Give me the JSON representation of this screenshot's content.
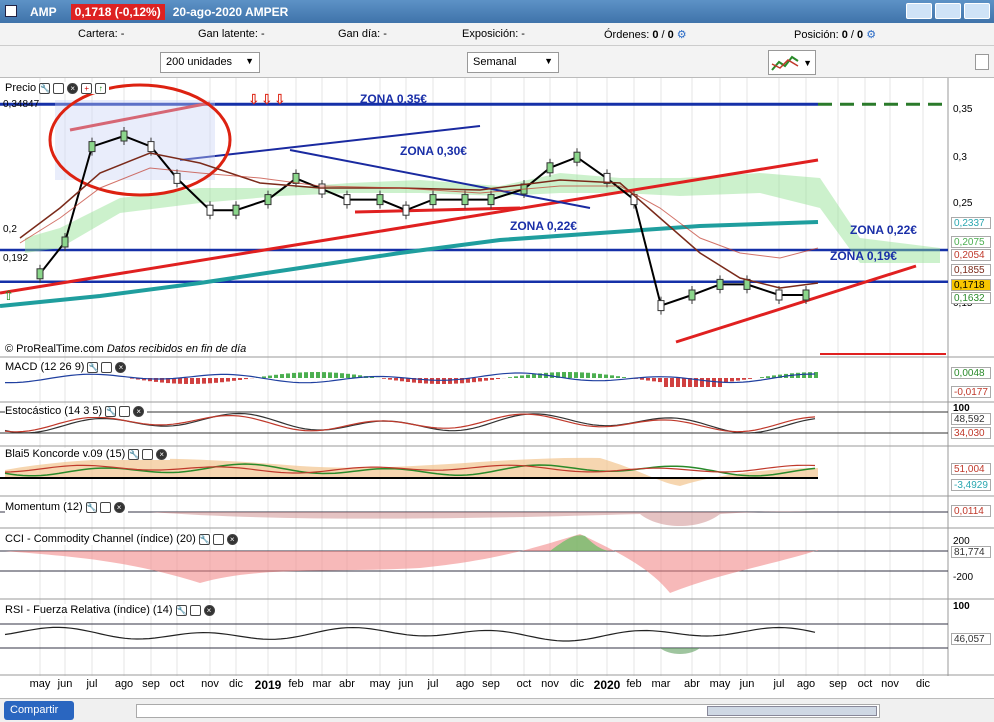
{
  "window": {
    "symbol": "AMP",
    "price_badge": "0,1718 (-0,12%)",
    "date_label": "20-ago-2020 AMPER"
  },
  "info": {
    "cartera": "Cartera: -",
    "gan_latente": "Gan latente: -",
    "gan_dia": "Gan día: -",
    "exposicion": "Exposición: -",
    "ordenes_label": "Órdenes: ",
    "ordenes_a": "0",
    "ordenes_b": "0",
    "posicion_label": "Posición: ",
    "posicion_a": "0",
    "posicion_b": "0"
  },
  "toolbar": {
    "units_select": "200 unidades",
    "period_select": "Semanal"
  },
  "panels": {
    "price": {
      "label": "Precio",
      "last_value": "0,34847",
      "left_value_1": "0,2",
      "left_value_2": "0,192",
      "copyright": "© ProRealTime.com",
      "copyright_note": "Datos recibidos en fin de día"
    },
    "macd": {
      "label": "MACD (12 26 9)"
    },
    "stoch": {
      "label": "Estocástico (14 3 5)"
    },
    "koncorde": {
      "label": "Blai5 Koncorde v.09 (15)"
    },
    "momentum": {
      "label": "Momentum (12)"
    },
    "cci": {
      "label": "CCI - Commodity Channel (índice) (20)"
    },
    "rsi": {
      "label": "RSI - Fuerza Relativa (índice) (14)"
    }
  },
  "zones": {
    "z035": "ZONA 0,35€",
    "z030": "ZONA 0,30€",
    "z022_mid": "ZONA 0,22€",
    "z022_right": "ZONA 0,22€",
    "z019": "ZONA 0,19€"
  },
  "price_axis": {
    "ticks": [
      "0,35",
      "0,3",
      "0,25",
      "0,2",
      "0,15"
    ],
    "tags": [
      {
        "text": "0,2337",
        "color": "#2aa7b0"
      },
      {
        "text": "0,2075",
        "color": "#4caf50"
      },
      {
        "text": "0,2054",
        "color": "#c0392b"
      },
      {
        "text": "0,1855",
        "color": "#7a2a1a"
      },
      {
        "text": "0,1718",
        "color": "#000000",
        "bg": "#f7c600"
      },
      {
        "text": "0,1632",
        "color": "#2a8a2a"
      }
    ]
  },
  "indicator_tags": {
    "macd": [
      {
        "text": "0,0048",
        "color": "#2a8a2a"
      },
      {
        "text": "-0,0177",
        "color": "#c0392b"
      }
    ],
    "stoch": [
      {
        "text": "100",
        "color": "#000"
      },
      {
        "text": "48,592",
        "color": "#333"
      },
      {
        "text": "34,030",
        "color": "#c0392b"
      }
    ],
    "koncorde": [
      {
        "text": "51,004",
        "color": "#c0392b"
      },
      {
        "text": "-3,4929",
        "color": "#2aa7b0"
      }
    ],
    "momentum": [
      {
        "text": "0,0114",
        "color": "#c0392b"
      }
    ],
    "cci": [
      {
        "text": "200",
        "color": "#000"
      },
      {
        "text": "81,774",
        "color": "#333"
      },
      {
        "text": "-200",
        "color": "#000"
      }
    ],
    "rsi": [
      {
        "text": "100",
        "color": "#000"
      },
      {
        "text": "46,057",
        "color": "#333"
      }
    ]
  },
  "time_axis": [
    {
      "label": "may",
      "bold": false
    },
    {
      "label": "jun",
      "bold": false
    },
    {
      "label": "jul",
      "bold": false
    },
    {
      "label": "ago",
      "bold": false
    },
    {
      "label": "sep",
      "bold": false
    },
    {
      "label": "oct",
      "bold": false
    },
    {
      "label": "nov",
      "bold": false
    },
    {
      "label": "dic",
      "bold": false
    },
    {
      "label": "2019",
      "bold": true
    },
    {
      "label": "feb",
      "bold": false
    },
    {
      "label": "mar",
      "bold": false
    },
    {
      "label": "abr",
      "bold": false
    },
    {
      "label": "may",
      "bold": false
    },
    {
      "label": "jun",
      "bold": false
    },
    {
      "label": "jul",
      "bold": false
    },
    {
      "label": "ago",
      "bold": false
    },
    {
      "label": "sep",
      "bold": false
    },
    {
      "label": "oct",
      "bold": false
    },
    {
      "label": "nov",
      "bold": false
    },
    {
      "label": "dic",
      "bold": false
    },
    {
      "label": "2020",
      "bold": true
    },
    {
      "label": "feb",
      "bold": false
    },
    {
      "label": "mar",
      "bold": false
    },
    {
      "label": "abr",
      "bold": false
    },
    {
      "label": "may",
      "bold": false
    },
    {
      "label": "jun",
      "bold": false
    },
    {
      "label": "jul",
      "bold": false
    },
    {
      "label": "ago",
      "bold": false
    },
    {
      "label": "sep",
      "bold": false
    },
    {
      "label": "oct",
      "bold": false
    },
    {
      "label": "nov",
      "bold": false
    },
    {
      "label": "dic",
      "bold": false
    }
  ],
  "bottom": {
    "share_button": "Compartir"
  },
  "chart_data": {
    "type": "line",
    "title": "",
    "ylim": [
      0.12,
      0.37
    ],
    "x": [
      "may",
      "jun",
      "jul",
      "ago",
      "sep",
      "oct",
      "nov",
      "dic",
      "2019",
      "feb",
      "mar",
      "abr",
      "may",
      "jun",
      "jul",
      "ago",
      "sep",
      "oct",
      "nov",
      "dic",
      "2020",
      "feb",
      "mar",
      "abr",
      "may",
      "jun",
      "jul",
      "ago"
    ],
    "series": [
      {
        "values": [
          0.19,
          0.22,
          0.31,
          0.32,
          0.31,
          0.28,
          0.25,
          0.25,
          0.26,
          0.28,
          0.27,
          0.26,
          0.26,
          0.25,
          0.26,
          0.26,
          0.26,
          0.27,
          0.29,
          0.3,
          0.28,
          0.26,
          0.16,
          0.17,
          0.18,
          0.18,
          0.17,
          0.17
        ],
        "color": "#000000"
      }
    ],
    "horizontal_levels": [
      0.35,
      0.3,
      0.22,
      0.19
    ]
  }
}
